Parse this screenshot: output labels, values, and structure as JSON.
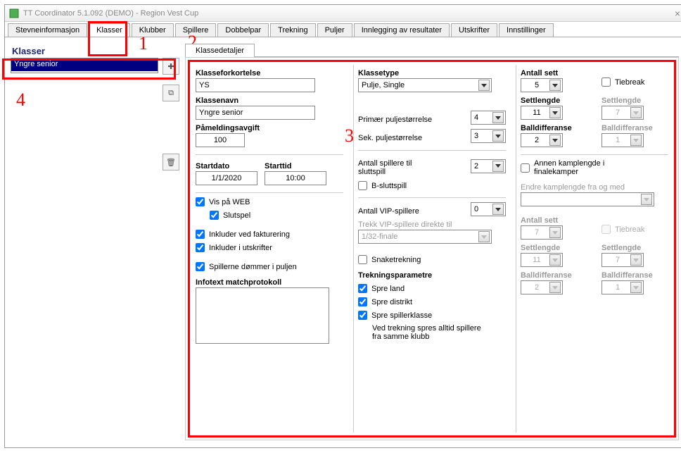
{
  "window": {
    "title": "TT Coordinator 5.1.092 (DEMO) - Region Vest Cup"
  },
  "tabs": [
    "Stevneinformasjon",
    "Klasser",
    "Klubber",
    "Spillere",
    "Dobbelpar",
    "Trekning",
    "Puljer",
    "Innlegging av resultater",
    "Utskrifter",
    "Innstillinger"
  ],
  "klasser_header": "Klasser",
  "klasser_list_item": "Yngre senior",
  "detail_tab": "Klassedetaljer",
  "left": {
    "klasseforkortelse_lbl": "Klasseforkortelse",
    "klasseforkortelse": "YS",
    "klassenavn_lbl": "Klassenavn",
    "klassenavn": "Yngre senior",
    "pameldingsavgift_lbl": "Påmeldingsavgift",
    "pameldingsavgift": "100",
    "startdato_lbl": "Startdato",
    "startdato": "1/1/2020",
    "starttid_lbl": "Starttid",
    "starttid": "10:00",
    "vis_web": "Vis på WEB",
    "slutspel": "Slutspel",
    "inkluder_fakt": "Inkluder ved fakturering",
    "inkluder_utskr": "Inkluder i utskrifter",
    "spillerne_dommer": "Spillerne dømmer i puljen",
    "infotext_lbl": "Infotext matchprotokoll"
  },
  "mid": {
    "klassetype_lbl": "Klassetype",
    "klassetype": "Pulje, Single",
    "primar_lbl": "Primær puljestørrelse",
    "primar": "4",
    "sek_lbl": "Sek. puljestørrelse",
    "sek": "3",
    "antall_sluttspill_lbl": "Antall spillere til sluttspill",
    "antall_sluttspill": "2",
    "b_sluttspill": "B-sluttspill",
    "antall_vip_lbl": "Antall VIP-spillere",
    "antall_vip": "0",
    "trekk_vip_lbl": "Trekk VIP-spillere direkte til",
    "trekk_vip": "1/32-finale",
    "snaketrekning": "Snaketrekning",
    "trekparam_lbl": "Trekningsparametre",
    "spre_land": "Spre land",
    "spre_distrikt": "Spre distrikt",
    "spre_spillerklasse": "Spre spillerklasse",
    "ved_trekning": "Ved trekning spres alltid spillere fra samme klubb"
  },
  "right": {
    "antall_sett_lbl": "Antall sett",
    "antall_sett": "5",
    "tiebreak": "Tiebreak",
    "settlengde_lbl": "Settlengde",
    "settlengde": "11",
    "settlengde2_lbl": "Settlengde",
    "settlengde2": "7",
    "balldiff_lbl": "Balldifferanse",
    "balldiff": "2",
    "balldiff2_lbl": "Balldifferanse",
    "balldiff2": "1",
    "annen_lbl": "Annen kamplengde i finalekamper",
    "endre_lbl": "Endre kamplengde fra og med",
    "antall_sett2_lbl": "Antall sett",
    "antall_sett2": "7",
    "tiebreak2": "Tiebreak",
    "settlengde3_lbl": "Settlengde",
    "settlengde3": "11",
    "settlengde4_lbl": "Settlengde",
    "settlengde4": "7",
    "balldiff3_lbl": "Balldifferanse",
    "balldiff3": "2",
    "balldiff4_lbl": "Balldifferanse",
    "balldiff4": "1"
  },
  "annotations": {
    "a1": "1",
    "a2": "2",
    "a3": "3",
    "a4": "4"
  }
}
